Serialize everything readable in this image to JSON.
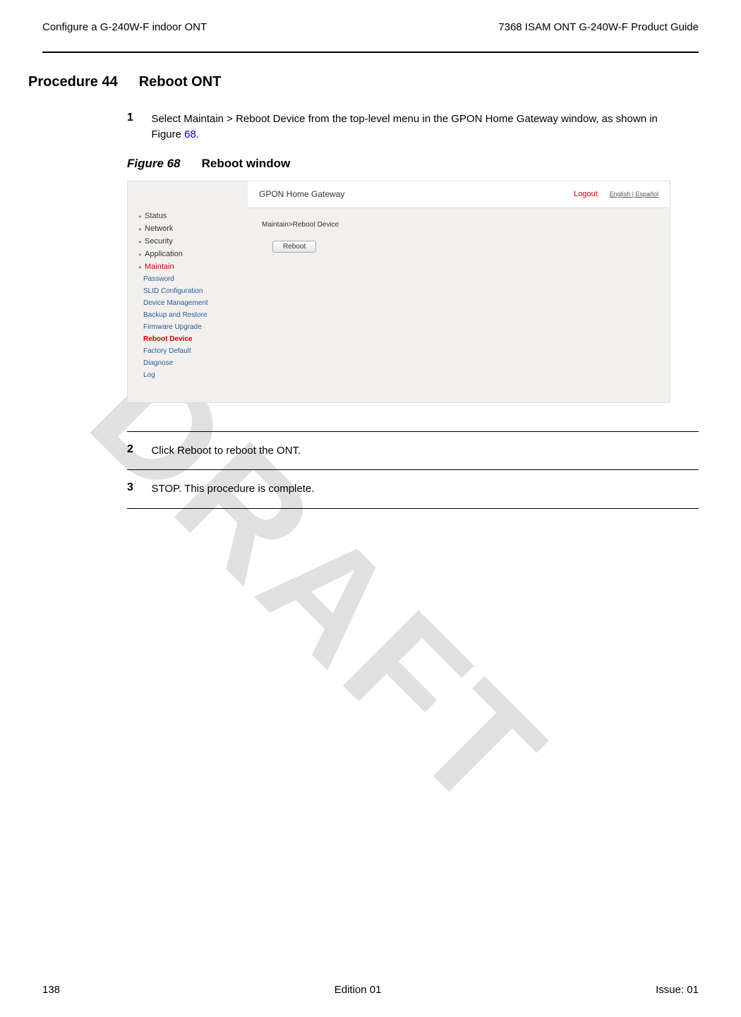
{
  "header": {
    "left": "Configure a G-240W-F indoor ONT",
    "right": "7368 ISAM ONT G-240W-F Product Guide"
  },
  "procedure": {
    "number": "Procedure 44",
    "title": "Reboot ONT"
  },
  "steps": {
    "s1": {
      "num": "1",
      "text_a": "Select Maintain > Reboot Device from the top-level menu in the GPON Home Gateway window, as shown in Figure ",
      "link": "68",
      "text_b": "."
    },
    "s2": {
      "num": "2",
      "text": "Click Reboot to reboot the ONT."
    },
    "s3": {
      "num": "3",
      "text": "STOP. This procedure is complete."
    }
  },
  "figure": {
    "label": "Figure 68",
    "title": "Reboot window"
  },
  "screenshot": {
    "title": "GPON Home Gateway",
    "logout": "Logout",
    "lang": "English | Español",
    "breadcrumb": "Maintain>Reboot Device",
    "reboot_button": "Reboot",
    "sidebar": {
      "status": "Status",
      "network": "Network",
      "security": "Security",
      "application": "Application",
      "maintain": "Maintain",
      "subs": {
        "password": "Password",
        "slid": "SLID Configuration",
        "device": "Device Management",
        "backup": "Backup and Restore",
        "firmware": "Firmware Upgrade",
        "reboot": "Reboot Device",
        "factory": "Factory Default",
        "diagnose": "Diagnose",
        "log": "Log"
      }
    }
  },
  "watermark": "DRAFT",
  "footer": {
    "page": "138",
    "edition": "Edition 01",
    "issue": "Issue: 01"
  }
}
